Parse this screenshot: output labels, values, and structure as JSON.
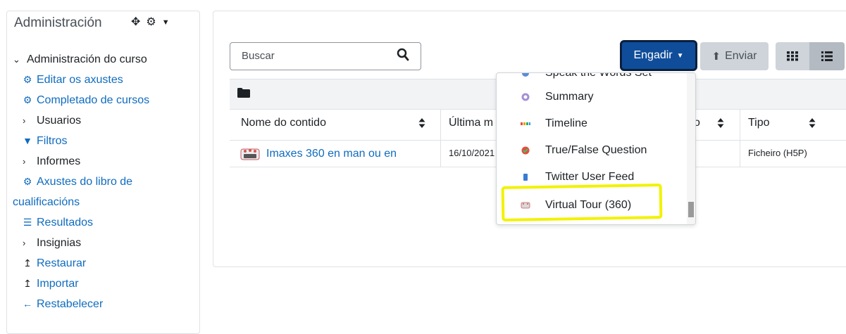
{
  "admin": {
    "title": "Administración",
    "items": [
      {
        "label": "Administración do curso"
      },
      {
        "label": "Editar os axustes"
      },
      {
        "label": "Completado de cursos"
      },
      {
        "label": "Usuarios"
      },
      {
        "label": "Filtros"
      },
      {
        "label": "Informes"
      },
      {
        "label": "Axustes do libro de"
      },
      {
        "label": "cualificacións"
      },
      {
        "label": "Resultados"
      },
      {
        "label": "Insignias"
      },
      {
        "label": "Restaurar"
      },
      {
        "label": "Importar"
      },
      {
        "label": "Restabelecer"
      }
    ]
  },
  "toolbar": {
    "search_placeholder": "Buscar",
    "add_label": "Engadir",
    "send_label": "Enviar"
  },
  "table": {
    "headers": [
      "Nome do contido",
      "Última m",
      "o",
      "Tipo"
    ],
    "row": {
      "name": "Imaxes 360 en man ou en",
      "date": "16/10/2021",
      "type": "Ficheiro (H5P)"
    }
  },
  "dropdown": {
    "items": [
      {
        "label": "Speak the Words Set"
      },
      {
        "label": "Summary"
      },
      {
        "label": "Timeline"
      },
      {
        "label": "True/False Question"
      },
      {
        "label": "Twitter User Feed"
      },
      {
        "label": "Virtual Tour (360)"
      }
    ]
  },
  "colors": {
    "primary": "#0f4d9a",
    "link": "#0f6cbf",
    "highlight": "#f2f200"
  }
}
